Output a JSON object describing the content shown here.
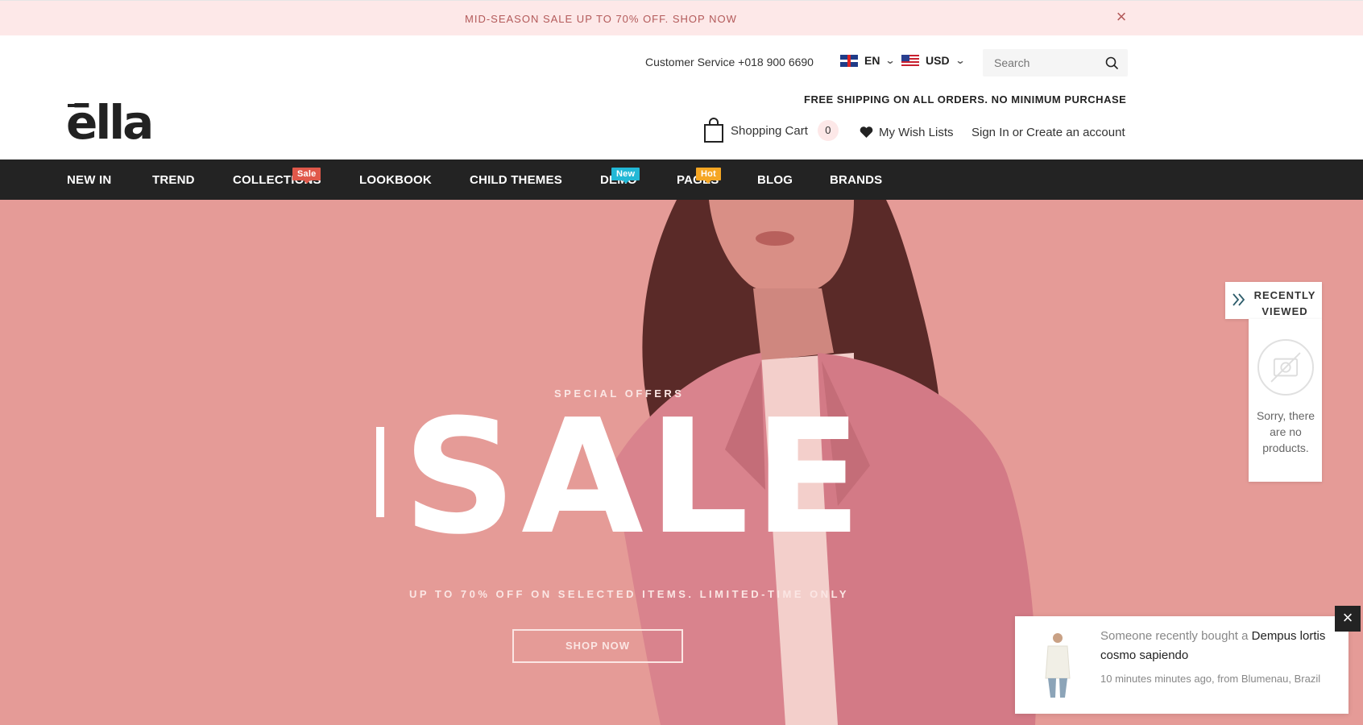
{
  "announcement": {
    "text": "MID-SEASON SALE UP TO 70% OFF. SHOP NOW",
    "close_icon": "×"
  },
  "header": {
    "customer_service": "Customer Service +018 900 6690",
    "language": "EN",
    "currency": "USD",
    "search_placeholder": "Search",
    "free_shipping": "FREE SHIPPING ON ALL ORDERS. NO MINIMUM PURCHASE",
    "logo": "ēlla",
    "cart_label": "Shopping Cart",
    "cart_count": "0",
    "wishlist_label": "My Wish Lists",
    "sign_in": "Sign In",
    "or": "or",
    "create_account": "Create an account"
  },
  "nav": {
    "items": [
      {
        "label": "NEW IN"
      },
      {
        "label": "TREND"
      },
      {
        "label": "COLLECTIONS",
        "badge": "Sale",
        "badge_color": "#e0584a"
      },
      {
        "label": "LOOKBOOK"
      },
      {
        "label": "CHILD THEMES"
      },
      {
        "label": "DEMO",
        "badge": "New",
        "badge_color": "#22b8d6"
      },
      {
        "label": "PAGES",
        "badge": "Hot",
        "badge_color": "#f5a623"
      },
      {
        "label": "BLOG"
      },
      {
        "label": "BRANDS"
      }
    ]
  },
  "hero": {
    "eyebrow": "SPECIAL OFFERS",
    "headline": "SALE",
    "subtitle": "UP TO 70% OFF ON SELECTED ITEMS. LIMITED-TIME ONLY",
    "button": "SHOP NOW",
    "background_color": "#e59b97"
  },
  "recently_viewed": {
    "title_line1": "RECENTLY",
    "title_line2": "VIEWED",
    "empty_text": "Sorry, there are no products."
  },
  "purchase_popup": {
    "prefix": "Someone recently bought a",
    "product": "Dempus lortis cosmo sapiendo",
    "meta": "10 minutes minutes ago, from Blumenau, Brazil"
  },
  "icons": {
    "search": "search-icon",
    "cart": "shopping-bag-icon",
    "wishlist": "heart-icon",
    "close": "close-icon",
    "chevron": "chevron-down-icon",
    "arrows": "double-chevron-right-icon"
  }
}
